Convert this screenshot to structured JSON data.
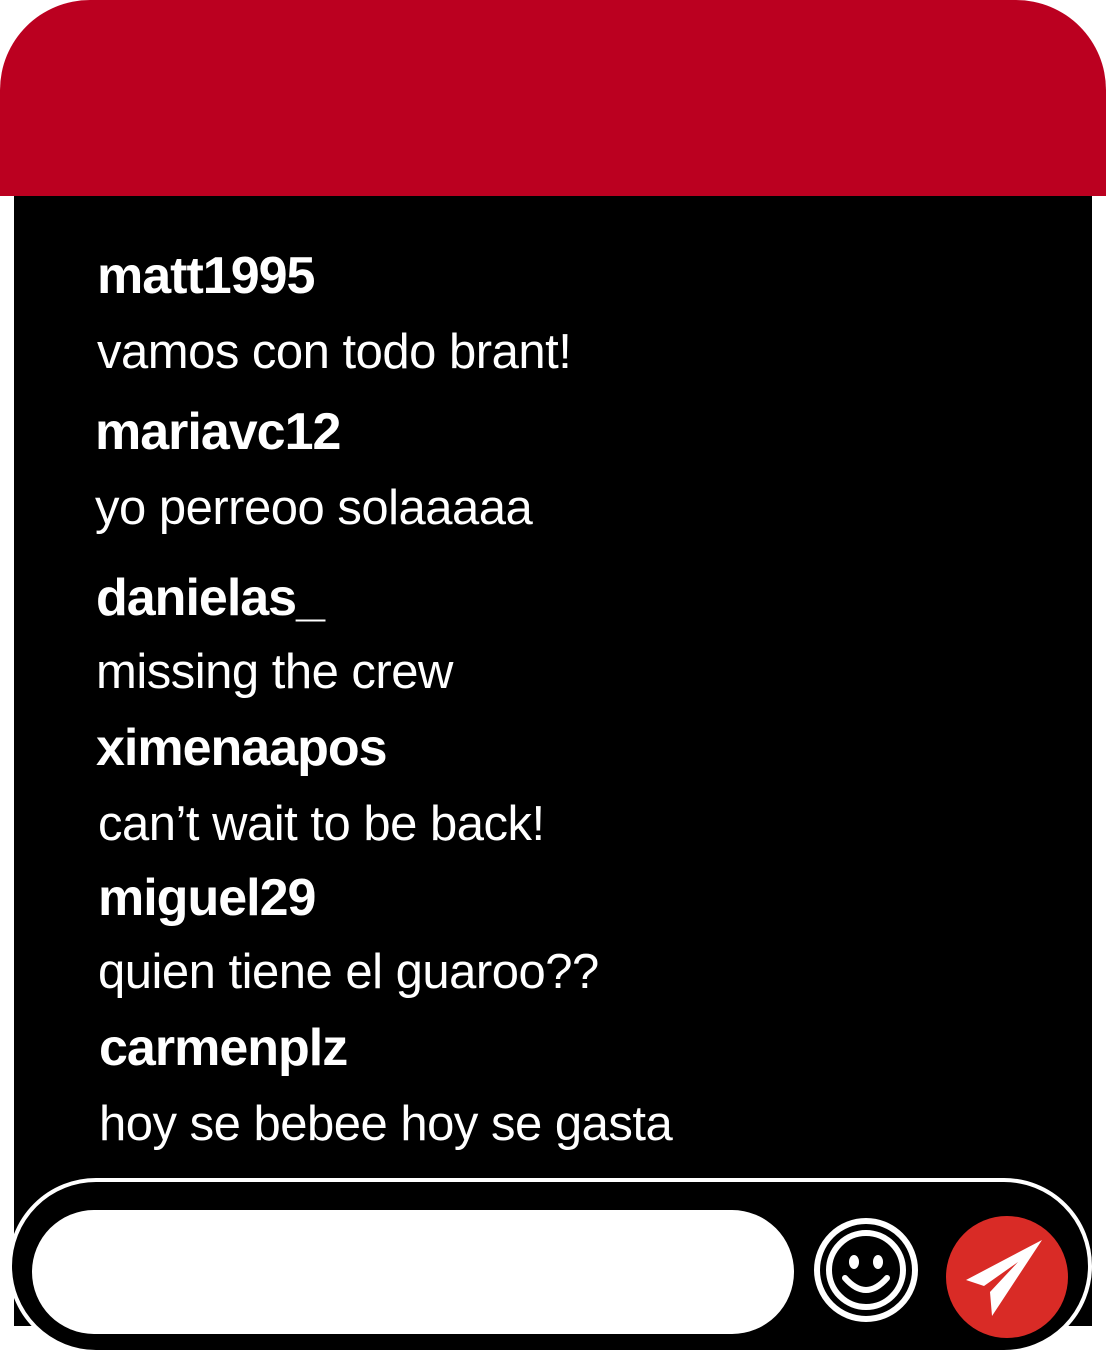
{
  "chat": {
    "messages": [
      {
        "user": "matt1995",
        "text": "vamos con todo brant!"
      },
      {
        "user": "mariavc12",
        "text": "yo perreoo solaaaaa"
      },
      {
        "user": "danielas_",
        "text": "missing the crew"
      },
      {
        "user": "ximenaapos",
        "text": "can’t wait to be back!"
      },
      {
        "user": "miguel29",
        "text": "quien tiene el guaroo??"
      },
      {
        "user": "carmenplz",
        "text": "hoy se bebee hoy se gasta"
      }
    ]
  },
  "composer": {
    "input_value": "",
    "placeholder": "",
    "emoji_icon": "smiley-face-icon",
    "send_icon": "paper-plane-icon"
  },
  "colors": {
    "header": "#bb0020",
    "panel": "#000000",
    "text": "#ffffff",
    "send_button": "#d92b26"
  }
}
